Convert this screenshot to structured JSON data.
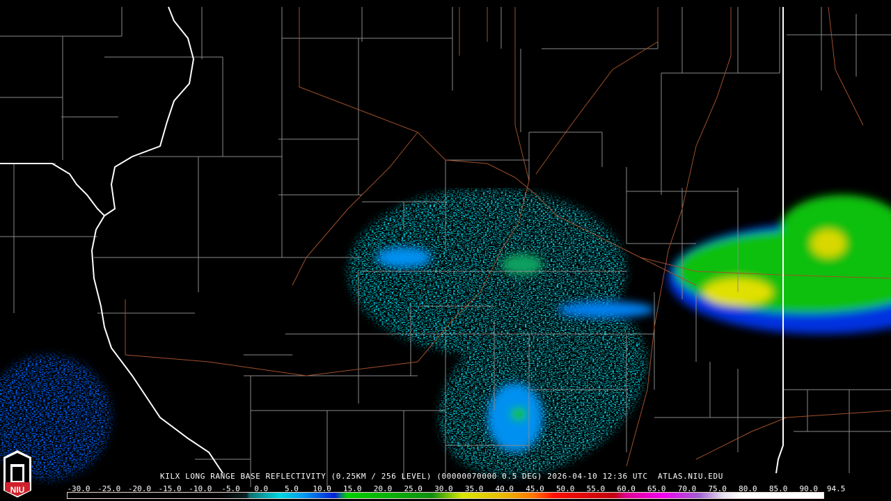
{
  "product": {
    "title": "KILX LONG RANGE BASE REFLECTIVITY (0.25KM / 256 LEVEL) (00000070000 0.5 DEG) 2026-04-10 12:36 UTC  ATLAS.NIU.EDU"
  },
  "logo": {
    "text": "NIU"
  },
  "colorbar": {
    "labels": [
      "-30.0",
      "-25.0",
      "-20.0",
      "-15.0",
      "-10.0",
      "-5.0",
      "0.0",
      "5.0",
      "10.0",
      "15.0",
      "20.0",
      "25.0",
      "30.0",
      "35.0",
      "40.0",
      "45.0",
      "50.0",
      "55.0",
      "60.0",
      "65.0",
      "70.0",
      "75.0",
      "80.0",
      "85.0",
      "90.0",
      "94.5"
    ],
    "min": -30,
    "max": 94.5,
    "stops": [
      {
        "value": -30,
        "color": "#000000"
      },
      {
        "value": -5,
        "color": "#000000"
      },
      {
        "value": -0.5,
        "color": "#0a2224"
      },
      {
        "value": 0,
        "color": "#0e7272"
      },
      {
        "value": 5,
        "color": "#00d8e0"
      },
      {
        "value": 9,
        "color": "#0098f0"
      },
      {
        "value": 14,
        "color": "#0020d8"
      },
      {
        "value": 15,
        "color": "#107880"
      },
      {
        "value": 16,
        "color": "#00d000"
      },
      {
        "value": 30,
        "color": "#109010"
      },
      {
        "value": 35,
        "color": "#d8e800"
      },
      {
        "value": 42,
        "color": "#e8b800"
      },
      {
        "value": 47,
        "color": "#ff7000"
      },
      {
        "value": 50,
        "color": "#ff1000"
      },
      {
        "value": 60,
        "color": "#c00010"
      },
      {
        "value": 62,
        "color": "#e00090"
      },
      {
        "value": 68,
        "color": "#f000f0"
      },
      {
        "value": 74,
        "color": "#a060d0"
      },
      {
        "value": 78,
        "color": "#e8e0f0"
      },
      {
        "value": 81,
        "color": "#ffffff"
      },
      {
        "value": 94.5,
        "color": "#ffffff"
      }
    ]
  }
}
